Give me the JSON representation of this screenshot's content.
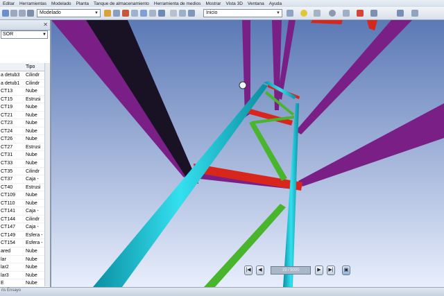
{
  "menu": [
    "Editar",
    "Herramientas",
    "Modelado",
    "Planta",
    "Tanque de almacenamiento",
    "Herramienta de medios",
    "Mostrar",
    "Vista 3D",
    "Ventana",
    "Ayuda"
  ],
  "toolbar": {
    "mode_combo": "Modelado",
    "view_combo": "Inicio"
  },
  "panel": {
    "filter_value": "SOR",
    "col_name": "",
    "col_type": "Tipo",
    "rows": [
      {
        "name": "a detub3",
        "type": "Cilindr"
      },
      {
        "name": "a detub1",
        "type": "Cilindr"
      },
      {
        "name": "CT13",
        "type": "Nube"
      },
      {
        "name": "CT15",
        "type": "Estrusi"
      },
      {
        "name": "CT19",
        "type": "Nube"
      },
      {
        "name": "CT21",
        "type": "Nube"
      },
      {
        "name": "CT23",
        "type": "Nube"
      },
      {
        "name": "CT24",
        "type": "Nube"
      },
      {
        "name": "CT26",
        "type": "Nube"
      },
      {
        "name": "CT27",
        "type": "Estrusi"
      },
      {
        "name": "CT31",
        "type": "Nube"
      },
      {
        "name": "CT33",
        "type": "Nube"
      },
      {
        "name": "CT35",
        "type": "Cilindr"
      },
      {
        "name": "CT37",
        "type": "Caja - "
      },
      {
        "name": "CT40",
        "type": "Estrusi"
      },
      {
        "name": "CT109",
        "type": "Nube"
      },
      {
        "name": "CT110",
        "type": "Nube"
      },
      {
        "name": "CT141",
        "type": "Caja - "
      },
      {
        "name": "CT144",
        "type": "Cilindr"
      },
      {
        "name": "CT147",
        "type": "Caja - "
      },
      {
        "name": "CT149",
        "type": "Esfera -"
      },
      {
        "name": "CT154",
        "type": "Esfera -"
      },
      {
        "name": "ared",
        "type": "Nube"
      },
      {
        "name": "lar",
        "type": "Nube"
      },
      {
        "name": "lar2",
        "type": "Nube"
      },
      {
        "name": "lar3",
        "type": "Nube"
      },
      {
        "name": "E",
        "type": "Nube"
      }
    ]
  },
  "status": {
    "text": "ris Ensayo"
  },
  "nav": {
    "field": "19 / 9000"
  },
  "colors": {
    "column": "#1fc4d6",
    "beam_purple": "#7a1f86",
    "beam_red": "#d8261c",
    "brace_green": "#49b52c",
    "sky_top": "#5b79b6",
    "sky_bottom": "#e8eefc"
  }
}
